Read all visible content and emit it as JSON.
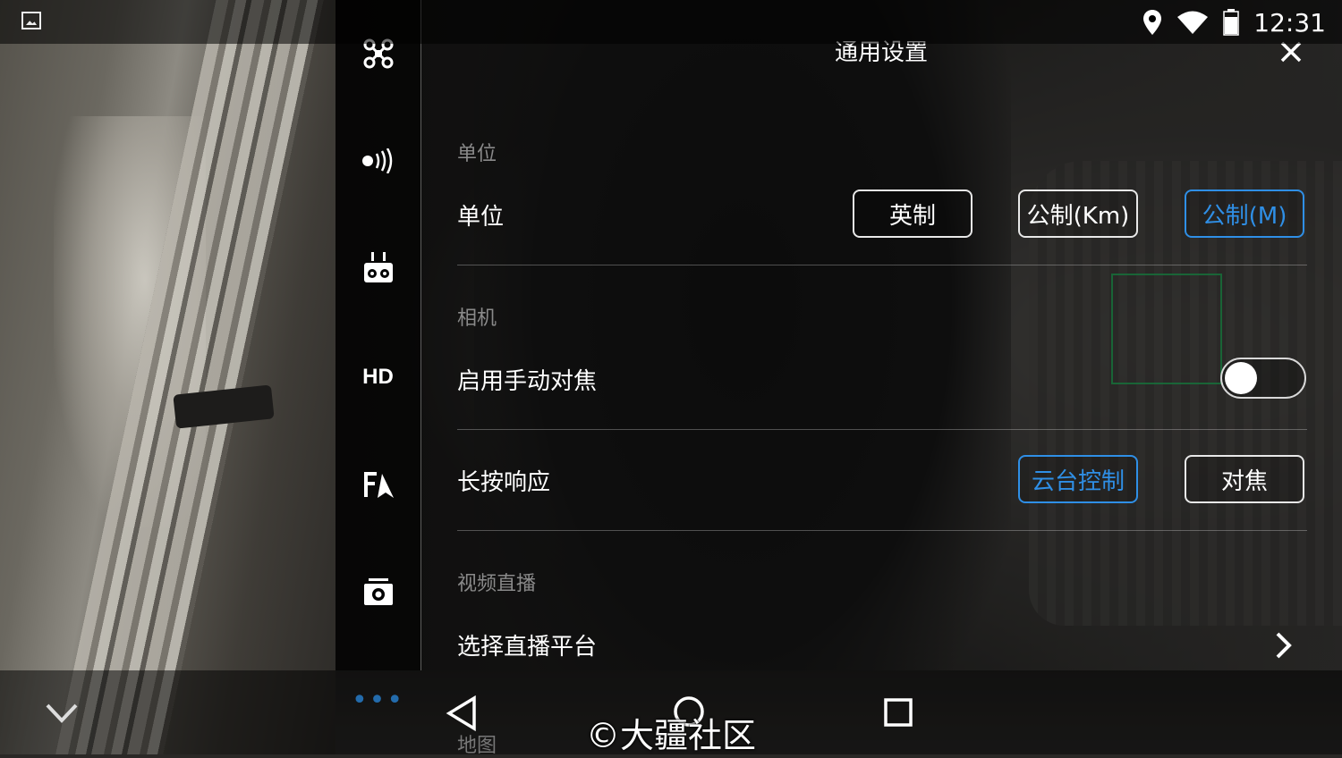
{
  "status_bar": {
    "time": "12:31",
    "icons": [
      "gallery-icon",
      "location-icon",
      "wifi-icon",
      "battery-icon"
    ]
  },
  "panel": {
    "title": "通用设置",
    "close_icon": "close-icon"
  },
  "sidebar": {
    "items": [
      {
        "name": "aircraft",
        "icon": "drone-icon"
      },
      {
        "name": "signal",
        "icon": "signal-icon"
      },
      {
        "name": "remote",
        "icon": "remote-controller-icon"
      },
      {
        "name": "hd",
        "label": "HD"
      },
      {
        "name": "visual",
        "icon": "visual-icon"
      },
      {
        "name": "camera",
        "icon": "camera-icon"
      },
      {
        "name": "more",
        "label": "•••"
      }
    ]
  },
  "sections": {
    "units": {
      "header": "单位",
      "row_label": "单位",
      "options": [
        "英制",
        "公制(Km)",
        "公制(M)"
      ],
      "selected": "公制(M)"
    },
    "camera": {
      "header": "相机",
      "manual_focus_label": "启用手动对焦",
      "manual_focus_enabled": false,
      "long_press_label": "长按响应",
      "long_press_options": [
        "云台控制",
        "对焦"
      ],
      "long_press_selected": "云台控制"
    },
    "live": {
      "header": "视频直播",
      "platform_label": "选择直播平台"
    }
  },
  "nav": {
    "map_label": "地图",
    "watermark": "©大疆社区"
  },
  "colors": {
    "accent": "#2f8fe6",
    "section_header": "#8a8a8a",
    "divider": "#ffffff47"
  }
}
